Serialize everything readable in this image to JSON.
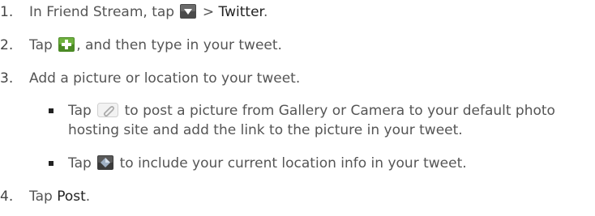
{
  "steps": [
    {
      "num": "1.",
      "pre": "In Friend Stream, tap",
      "icon": "dropdown-arrow-icon",
      "mid": " > ",
      "bold": "Twitter",
      "post": "."
    },
    {
      "num": "2.",
      "pre": "Tap",
      "icon": "plus-icon",
      "post": ", and then type in your tweet."
    },
    {
      "num": "3.",
      "text": "Add a picture or location to your tweet."
    },
    {
      "num": "4.",
      "pre": "Tap ",
      "bold": "Post",
      "post": "."
    }
  ],
  "bullets": [
    {
      "pre": "Tap",
      "icon": "paperclip-icon",
      "post": "to post a picture from Gallery or Camera to your default photo hosting site and add the link to the picture in your tweet."
    },
    {
      "pre": "Tap",
      "icon": "location-icon",
      "post": "to include your current location info in your tweet."
    }
  ],
  "colors": {
    "text": "#555555",
    "emphasis": "#222222",
    "icon_bg": "#3a3a3a",
    "plus_bg": "#5a9a2e"
  }
}
